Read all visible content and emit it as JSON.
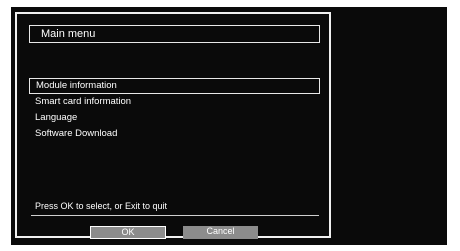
{
  "dialog": {
    "title": "Main menu",
    "items": [
      {
        "label": "Module information",
        "selected": true
      },
      {
        "label": "Smart card information",
        "selected": false
      },
      {
        "label": "Language",
        "selected": false
      },
      {
        "label": "Software Download",
        "selected": false
      }
    ],
    "hint": "Press OK to select, or Exit to quit",
    "ok_label": "OK",
    "cancel_label": "Cancel"
  },
  "colors": {
    "screen_background": "#0a0a0a",
    "text": "#ffffff",
    "button_background": "#8c8c8c",
    "frame": "#f0f0f0"
  }
}
